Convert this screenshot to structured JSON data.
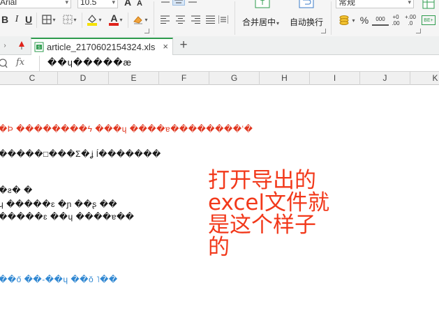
{
  "ribbon": {
    "font_name": "Arial",
    "font_size": "10.5",
    "bold_label": "B",
    "italic_label": "I",
    "underline_label": "U",
    "grow_font_label": "A",
    "shrink_font_label": "A",
    "font_color_label": "A",
    "merge_center_label": "合并居中",
    "wrap_text_label": "自动换行",
    "number_format_value": "常规",
    "percent_label": "%",
    "comma_label": "000",
    "inc_decimal_label": "+0\n.00",
    "dec_decimal_label": "+.00\n.0",
    "icons": [
      "borders-icon",
      "fill-color-icon",
      "font-color-icon",
      "clear-format-icon",
      "align-left-icon",
      "align-center-icon",
      "align-right-icon",
      "justify-icon",
      "distributed-icon",
      "merge-center-icon",
      "wrap-text-icon",
      "currency-icon",
      "percent-icon",
      "comma-style-icon",
      "increase-decimal-icon",
      "decrease-decimal-icon",
      "conditional-format-icon"
    ]
  },
  "tabbar": {
    "file_name": "article_2170602154324.xls",
    "close_symbol": "×",
    "new_tab_symbol": "+"
  },
  "formula_bar": {
    "fx_label": "fx",
    "value": "��ɥ�����æ"
  },
  "columns": [
    "C",
    "D",
    "E",
    "F",
    "G",
    "H",
    "I",
    "J",
    "K"
  ],
  "cells": {
    "row_red": "�Ϸ ��������ϟ ���ɥ ����ɐ��������ʻ�",
    "row_dark_1": "�����□���Σ�ʝ ĺ�������",
    "row_dark_2": "�ƨ� �",
    "row_dark_3": "ɥ �����ɛ �ɲ ��ʂ ��",
    "row_dark_4": "�����ɛ ��ɥ ����ɐ��",
    "row_blue": "��ő ��-��ɥ ��ŏ ˥��"
  },
  "annotation": {
    "line1": "打开导出的",
    "line2": "excel文件就",
    "line3": "是这个样子",
    "line4": "的"
  },
  "colors": {
    "annotation": "#f2381a",
    "red_text": "#e0361f",
    "blue_text": "#2f87d2",
    "tab_accent": "#2d9b4d"
  }
}
